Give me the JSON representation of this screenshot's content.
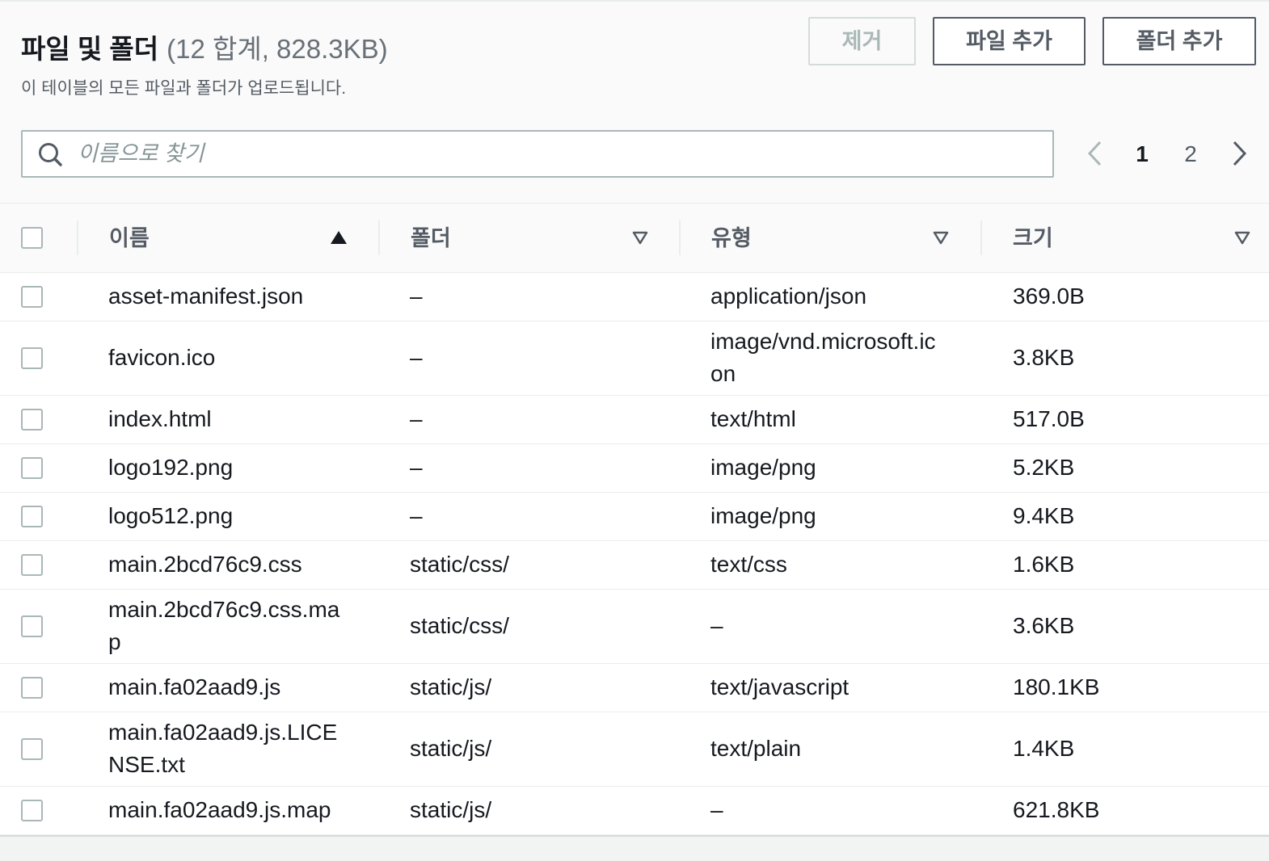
{
  "header": {
    "title": "파일 및 폴더",
    "count_summary": "(12 합계, 828.3KB)",
    "description": "이 테이블의 모든 파일과 폴더가 업로드됩니다."
  },
  "actions": {
    "remove": {
      "label": "제거",
      "disabled": true
    },
    "add_files": {
      "label": "파일 추가"
    },
    "add_folder": {
      "label": "폴더 추가"
    }
  },
  "search": {
    "icon": "search-icon",
    "placeholder": "이름으로 찾기"
  },
  "pagination": {
    "previous_icon": "chevron-left-icon",
    "previous_disabled": true,
    "next_icon": "chevron-right-icon",
    "pages": [
      {
        "label": "1",
        "current": true
      },
      {
        "label": "2",
        "current": false
      }
    ]
  },
  "table": {
    "select_all_checked": false,
    "columns": [
      {
        "label": "이름",
        "sort_icon": "sort-caret-up-icon"
      },
      {
        "label": "폴더",
        "sort_icon": "sort-caret-down-icon"
      },
      {
        "label": "유형",
        "sort_icon": "sort-caret-down-icon"
      },
      {
        "label": "크기",
        "sort_icon": "sort-caret-down-icon"
      }
    ],
    "rows": [
      {
        "selected": false,
        "name": "asset-manifest.json",
        "folder": "–",
        "type": "application/json",
        "size": "369.0B"
      },
      {
        "selected": false,
        "name": "favicon.ico",
        "folder": "–",
        "type": "image/vnd.microsoft.icon",
        "size": "3.8KB"
      },
      {
        "selected": false,
        "name": "index.html",
        "folder": "–",
        "type": "text/html",
        "size": "517.0B"
      },
      {
        "selected": false,
        "name": "logo192.png",
        "folder": "–",
        "type": "image/png",
        "size": "5.2KB"
      },
      {
        "selected": false,
        "name": "logo512.png",
        "folder": "–",
        "type": "image/png",
        "size": "9.4KB"
      },
      {
        "selected": false,
        "name": "main.2bcd76c9.css",
        "folder": "static/css/",
        "type": "text/css",
        "size": "1.6KB"
      },
      {
        "selected": false,
        "name": "main.2bcd76c9.css.map",
        "folder": "static/css/",
        "type": "–",
        "size": "3.6KB"
      },
      {
        "selected": false,
        "name": "main.fa02aad9.js",
        "folder": "static/js/",
        "type": "text/javascript",
        "size": "180.1KB"
      },
      {
        "selected": false,
        "name": "main.fa02aad9.js.LICENSE.txt",
        "folder": "static/js/",
        "type": "text/plain",
        "size": "1.4KB"
      },
      {
        "selected": false,
        "name": "main.fa02aad9.js.map",
        "folder": "static/js/",
        "type": "–",
        "size": "621.8KB"
      }
    ]
  },
  "colors": {
    "text_primary": "#16191f",
    "text_secondary": "#545b64",
    "text_muted": "#687078",
    "placeholder": "#879596",
    "disabled": "#aab7b8",
    "disabled_border": "#d5dbdb",
    "border": "#eaeded",
    "header_background": "#fafafa",
    "page_background": "#f2f3f3",
    "surface": "#ffffff"
  }
}
